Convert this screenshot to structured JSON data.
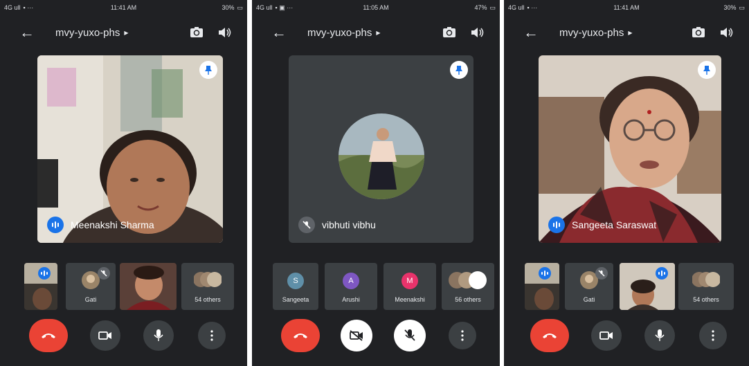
{
  "phones": [
    {
      "status": {
        "left": "4G ull",
        "time": "11:41 AM",
        "right": "30%"
      },
      "meeting_code": "mvy-yuxo-phs",
      "main_participant": "Meenakshi Sharma",
      "thumbnails": [
        {
          "label": ""
        },
        {
          "label": "Gati"
        },
        {
          "label": ""
        },
        {
          "label": "54 others"
        }
      ]
    },
    {
      "status": {
        "left": "4G ull",
        "time": "11:05 AM",
        "right": "47%"
      },
      "meeting_code": "mvy-yuxo-phs",
      "main_participant": "vibhuti vibhu",
      "thumbnails": [
        {
          "label": "Sangeeta",
          "initial": "S",
          "color": "#5f8fa8"
        },
        {
          "label": "Arushi",
          "initial": "A",
          "color": "#7e57c2"
        },
        {
          "label": "Meenakshi",
          "initial": "M",
          "color": "#e8336b"
        },
        {
          "label": "56 others"
        }
      ]
    },
    {
      "status": {
        "left": "4G ull",
        "time": "11:41 AM",
        "right": "30%"
      },
      "meeting_code": "mvy-yuxo-phs",
      "main_participant": "Sangeeta Saraswat",
      "thumbnails": [
        {
          "label": ""
        },
        {
          "label": "Gati"
        },
        {
          "label": ""
        },
        {
          "label": "54 others"
        }
      ]
    }
  ],
  "colors": {
    "background": "#202124",
    "end_call": "#ea4335",
    "audio_active": "#1a73e8",
    "tile": "#3c4043"
  }
}
